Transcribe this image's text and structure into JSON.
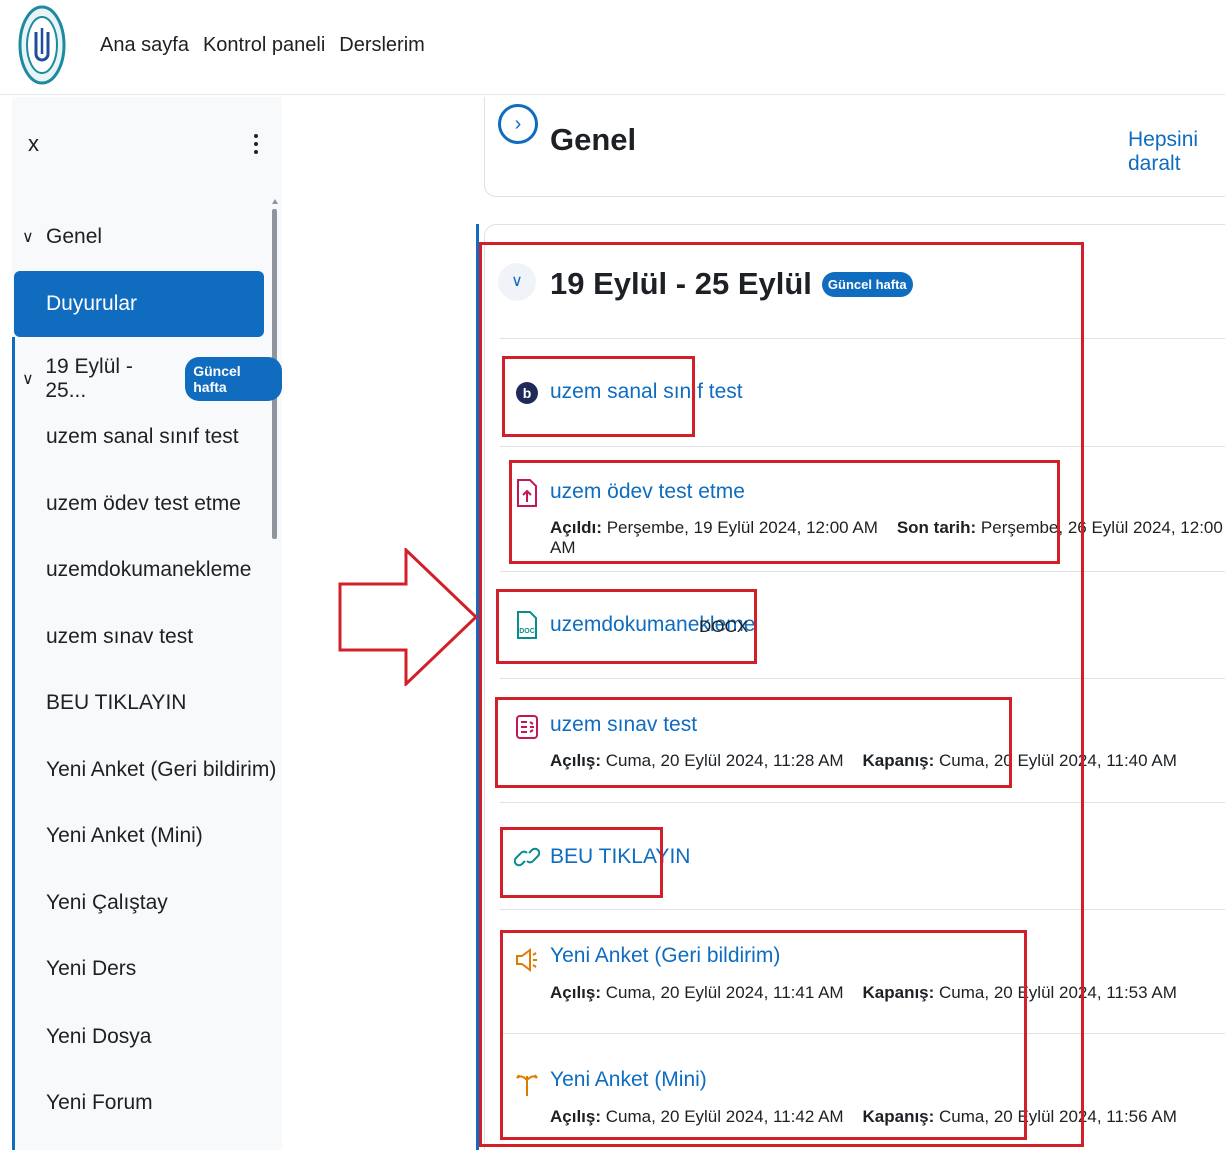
{
  "nav": {
    "links": [
      "Ana sayfa",
      "Kontrol paneli",
      "Derslerim"
    ]
  },
  "drawer": {
    "close_label": "x",
    "sections": [
      {
        "title": "Genel",
        "items": [
          "Duyurular"
        ]
      },
      {
        "title": "19 Eylül - 25...",
        "badge": "Güncel hafta",
        "items": [
          "uzem sanal sınıf test",
          "uzem ödev test etme",
          "uzemdokumanekleme",
          "uzem sınav test",
          "BEU TIKLAYIN",
          "Yeni Anket (Geri bildirim)",
          "Yeni Anket (Mini)",
          "Yeni Çalıştay",
          "Yeni Ders",
          "Yeni Dosya",
          "Yeni Forum"
        ]
      }
    ]
  },
  "main": {
    "section_title": "Genel",
    "collapse_all": "Hepsini daralt",
    "week": {
      "title": "19 Eylül - 25 Eylül",
      "badge": "Güncel hafta",
      "activities": [
        {
          "name": "uzem sanal sınıf test",
          "icon": "bigbluebutton-icon"
        },
        {
          "name": "uzem ödev test etme",
          "icon": "assignment-upload-icon",
          "d1_label": "Açıldı:",
          "d1_value": "Perşembe, 19 Eylül 2024, 12:00 AM",
          "d2_label": "Son tarih:",
          "d2_value": "Perşembe, 26 Eylül 2024, 12:00 AM"
        },
        {
          "name": "uzemdokumanekleme",
          "icon": "doc-file-icon",
          "type": "DOCX"
        },
        {
          "name": "uzem sınav test",
          "icon": "quiz-icon",
          "d1_label": "Açılış:",
          "d1_value": "Cuma, 20 Eylül 2024, 11:28 AM",
          "d2_label": "Kapanış:",
          "d2_value": "Cuma, 20 Eylül 2024, 11:40 AM"
        },
        {
          "name": "BEU TIKLAYIN",
          "icon": "link-icon"
        },
        {
          "name": "Yeni Anket (Geri bildirim)",
          "icon": "megaphone-icon",
          "d1_label": "Açılış:",
          "d1_value": "Cuma, 20 Eylül 2024, 11:41 AM",
          "d2_label": "Kapanış:",
          "d2_value": "Cuma, 20 Eylül 2024, 11:53 AM"
        },
        {
          "name": "Yeni Anket (Mini)",
          "icon": "choice-signpost-icon",
          "d1_label": "Açılış:",
          "d1_value": "Cuma, 20 Eylül 2024, 11:42 AM",
          "d2_label": "Kapanış:",
          "d2_value": "Cuma, 20 Eylül 2024, 11:56 AM"
        }
      ]
    }
  },
  "colors": {
    "accent": "#0f6cbf",
    "highlight_box": "#d1202a",
    "drawer_bg": "#f8f9fa"
  }
}
